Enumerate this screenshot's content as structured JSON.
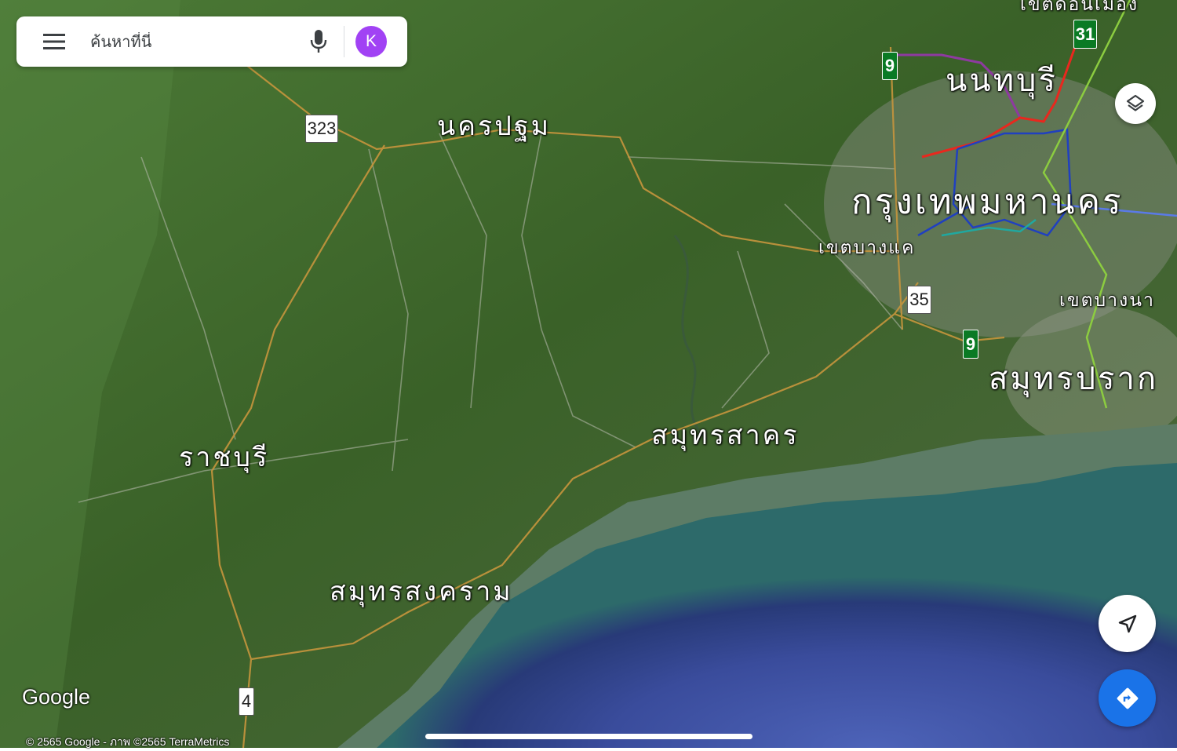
{
  "search": {
    "placeholder": "ค้นหาที่นี่",
    "avatar_letter": "K"
  },
  "places": {
    "nonthaburi": "นนทบุรี",
    "nakhon_pathom": "นครปฐม",
    "bangkok": "กรุงเทพมหานคร",
    "bang_khae": "เขตบางแค",
    "bang_na": "เขตบางนา",
    "samut_prakan": "สมุทรปราก",
    "samut_sakhon": "สมุทรสาคร",
    "ratchaburi": "ราชบุรี",
    "samut_songkhram": "สมุทรสงคราม",
    "don_mueang": "เขตดอนเมือง"
  },
  "routes": {
    "r323": "323",
    "r35": "35",
    "r4": "4",
    "r9a": "9",
    "r9b": "9",
    "r31": "31"
  },
  "attribution": {
    "logo": "Google",
    "copyright": "© 2565 Google - ภาพ ©2565 TerraMetrics"
  },
  "icons": {
    "menu": "menu-icon",
    "mic": "microphone-icon",
    "layers": "layers-icon",
    "locate": "navigation-arrow-icon",
    "directions": "directions-icon"
  },
  "colors": {
    "avatar": "#a142f4",
    "directions_fab": "#1a73e8",
    "sea": "#3f55a8",
    "land": "#3d6a2c"
  }
}
